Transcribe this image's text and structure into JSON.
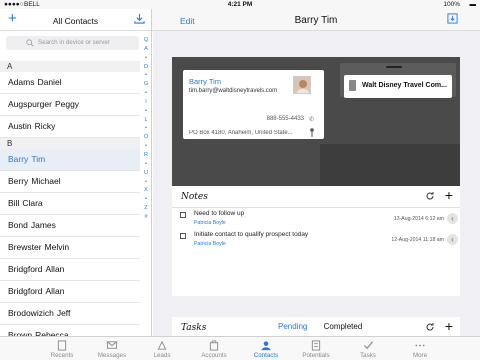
{
  "status": {
    "carrier": "BELL",
    "time": "4:21 PM",
    "battery": "100%"
  },
  "left": {
    "title": "All Contacts",
    "add_icon": "+",
    "search_placeholder": "Search in device or server",
    "sections": [
      {
        "letter": "A",
        "rows": [
          {
            "first": "Adams",
            "last": "Daniel"
          },
          {
            "first": "Augspurger",
            "last": "Peggy"
          },
          {
            "first": "Austin",
            "last": "Ricky"
          }
        ]
      },
      {
        "letter": "B",
        "rows": [
          {
            "first": "Barry",
            "last": "Tim",
            "selected": true
          },
          {
            "first": "Berry",
            "last": "Michael"
          },
          {
            "first": "Bill",
            "last": "Clara"
          },
          {
            "first": "Bond",
            "last": "James"
          },
          {
            "first": "Brewster",
            "last": "Melvin"
          },
          {
            "first": "Bridgford",
            "last": "Allan"
          },
          {
            "first": "Bridgford",
            "last": "Allan"
          },
          {
            "first": "Brodowizich",
            "last": "Jeff"
          },
          {
            "first": "Brown",
            "last": "Rebecca"
          }
        ]
      }
    ],
    "index": [
      "Q",
      "A",
      "•",
      "D",
      "•",
      "G",
      "•",
      "I",
      "•",
      "L",
      "•",
      "O",
      "•",
      "R",
      "•",
      "U",
      "•",
      "X",
      "•",
      "Z",
      "#"
    ]
  },
  "top": {
    "edit": "Edit",
    "title": "Barry Tim"
  },
  "card": {
    "name": "Barry Tim",
    "email": "tim.barry@waltdisneytravels.com",
    "phone": "888-555-4433",
    "address": "PO Box 4180, Anaheim, United State...",
    "company": "Walt Disney Travel Com..."
  },
  "notes": {
    "title": "Notes",
    "items": [
      {
        "text": "Need to follow up",
        "author": "Patricia Boyle",
        "date": "13-Aug-2014 6:12 am"
      },
      {
        "text": "Initiate contact to qualify prospect today",
        "author": "Patricia Boyle",
        "date": "12-Aug-2014 11:18 am"
      }
    ]
  },
  "tasks": {
    "title": "Tasks",
    "tab_pending": "Pending",
    "tab_completed": "Completed"
  },
  "tabbar": [
    {
      "label": "Recents",
      "icon": "recents-icon"
    },
    {
      "label": "Messages",
      "icon": "messages-icon"
    },
    {
      "label": "Leads",
      "icon": "leads-icon"
    },
    {
      "label": "Accounts",
      "icon": "accounts-icon"
    },
    {
      "label": "Contacts",
      "icon": "contacts-icon",
      "active": true
    },
    {
      "label": "Potentials",
      "icon": "potentials-icon"
    },
    {
      "label": "Tasks",
      "icon": "tasks-icon"
    },
    {
      "label": "More",
      "icon": "more-icon"
    }
  ],
  "colors": {
    "accent": "#2a78d4",
    "card_bg": "#4a4a4a"
  }
}
